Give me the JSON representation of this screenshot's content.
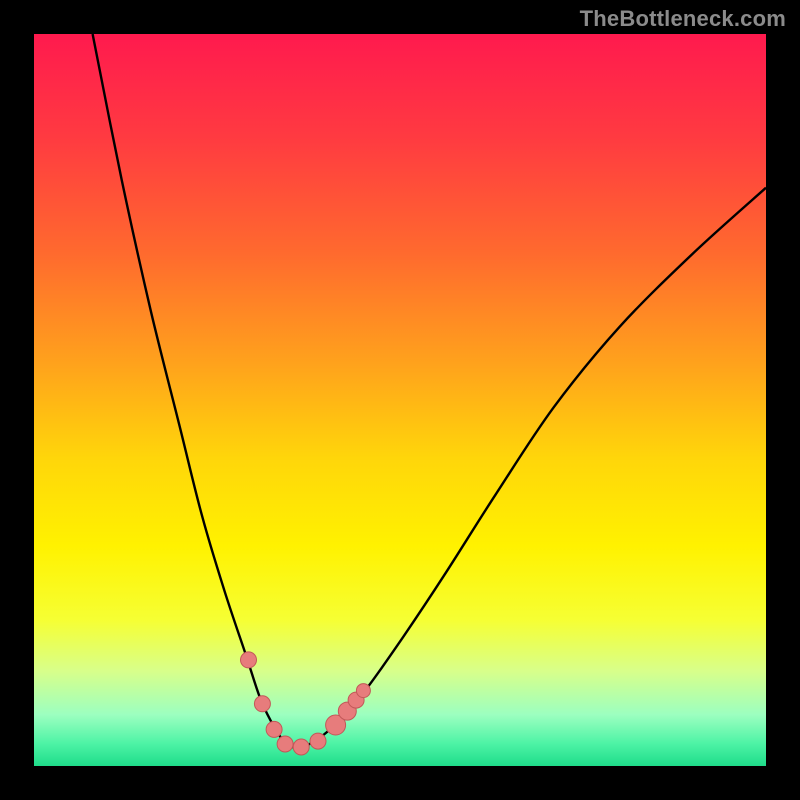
{
  "watermark": "TheBottleneck.com",
  "colors": {
    "background": "#000000",
    "curve_stroke": "#000000",
    "marker_fill": "#e77c7c",
    "marker_stroke": "#c25858",
    "gradient_stops": [
      {
        "offset": 0.0,
        "color": "#ff1a4e"
      },
      {
        "offset": 0.14,
        "color": "#ff3a41"
      },
      {
        "offset": 0.3,
        "color": "#ff6a2e"
      },
      {
        "offset": 0.45,
        "color": "#ffa21c"
      },
      {
        "offset": 0.58,
        "color": "#ffd60a"
      },
      {
        "offset": 0.7,
        "color": "#fff200"
      },
      {
        "offset": 0.8,
        "color": "#f6ff33"
      },
      {
        "offset": 0.87,
        "color": "#d8ff8a"
      },
      {
        "offset": 0.93,
        "color": "#9cffc0"
      },
      {
        "offset": 0.97,
        "color": "#4cf3a5"
      },
      {
        "offset": 1.0,
        "color": "#1fdc8a"
      }
    ]
  },
  "chart_data": {
    "type": "line",
    "title": "",
    "xlabel": "",
    "ylabel": "",
    "xlim": [
      0,
      100
    ],
    "ylim": [
      0,
      100
    ],
    "series": [
      {
        "name": "curve",
        "x": [
          8,
          12,
          16,
          20,
          23,
          26,
          29,
          31,
          33,
          34.5,
          36,
          38,
          41,
          45,
          50,
          56,
          63,
          71,
          80,
          90,
          100
        ],
        "y": [
          100,
          80,
          62,
          46,
          34,
          24,
          15,
          9,
          5,
          3,
          2.5,
          3.2,
          5.5,
          10,
          17,
          26,
          37,
          49,
          60,
          70,
          79
        ]
      }
    ],
    "markers": {
      "name": "highlighted-points",
      "x": [
        29.3,
        31.2,
        32.8,
        34.3,
        36.5,
        38.8,
        41.2,
        42.8,
        44.0,
        45.0
      ],
      "y": [
        14.5,
        8.5,
        5.0,
        3.0,
        2.6,
        3.4,
        5.6,
        7.5,
        9.0,
        10.3
      ],
      "r": [
        8,
        8,
        8,
        8,
        8,
        8,
        10,
        9,
        8,
        7
      ]
    }
  }
}
